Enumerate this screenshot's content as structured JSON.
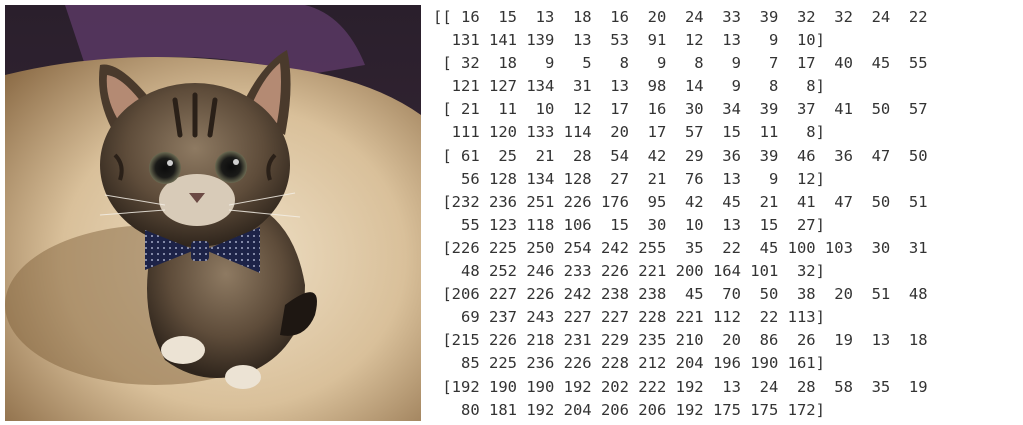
{
  "matrix_lines": [
    "[[ 16  15  13  18  16  20  24  33  39  32  32  24  22",
    "  131 141 139  13  53  91  12  13   9  10]",
    " [ 32  18   9   5   8   9   8   9   7  17  40  45  55",
    "  121 127 134  31  13  98  14   9   8   8]",
    " [ 21  11  10  12  17  16  30  34  39  37  41  50  57",
    "  111 120 133 114  20  17  57  15  11   8]",
    " [ 61  25  21  28  54  42  29  36  39  46  36  47  50",
    "   56 128 134 128  27  21  76  13   9  12]",
    " [232 236 251 226 176  95  42  45  21  41  47  50  51",
    "   55 123 118 106  15  30  10  13  15  27]",
    " [226 225 250 254 242 255  35  22  45 100 103  30  31",
    "   48 252 246 233 226 221 200 164 101  32]",
    " [206 227 226 242 238 238  45  70  50  38  20  51  48",
    "   69 237 243 227 227 228 221 112  22 113]",
    " [215 226 218 231 229 235 210  20  86  26  19  13  18",
    "   85 225 236 226 228 212 204 196 190 161]",
    " [192 190 190 192 202 222 192  13  24  28  58  35  19",
    "   80 181 192 204 206 206 192 175 175 172]"
  ]
}
